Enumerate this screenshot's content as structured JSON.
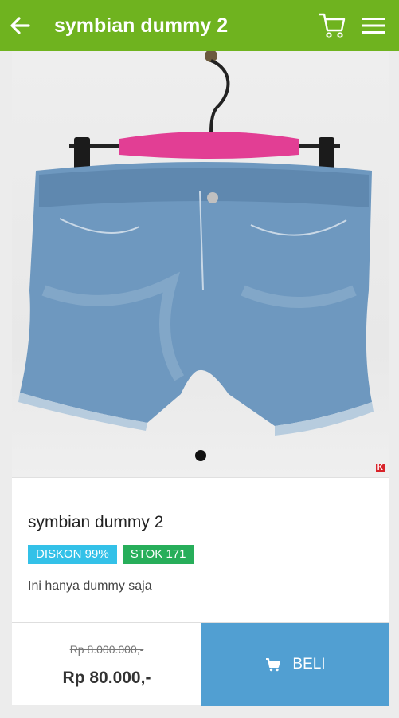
{
  "appbar": {
    "title": "symbian dummy 2",
    "background": "#6fb31f"
  },
  "icons": {
    "back": "arrow-left-icon",
    "cart": "cart-icon",
    "menu": "hamburger-menu-icon"
  },
  "gallery": {
    "image": "denim-shorts-on-hanger",
    "current_index": 1,
    "total": 1,
    "watermark": "K"
  },
  "product": {
    "name": "symbian dummy 2",
    "discount_badge": "DISKON 99%",
    "stock_badge": "STOK 171",
    "description": "Ini hanya dummy saja",
    "old_price": "Rp 8.000.000,-",
    "price": "Rp 80.000,-"
  },
  "actions": {
    "buy_label": "BELI",
    "buy_color": "#519fd2"
  },
  "colors": {
    "discount": "#33c1e8",
    "stock": "#27ae5a"
  }
}
